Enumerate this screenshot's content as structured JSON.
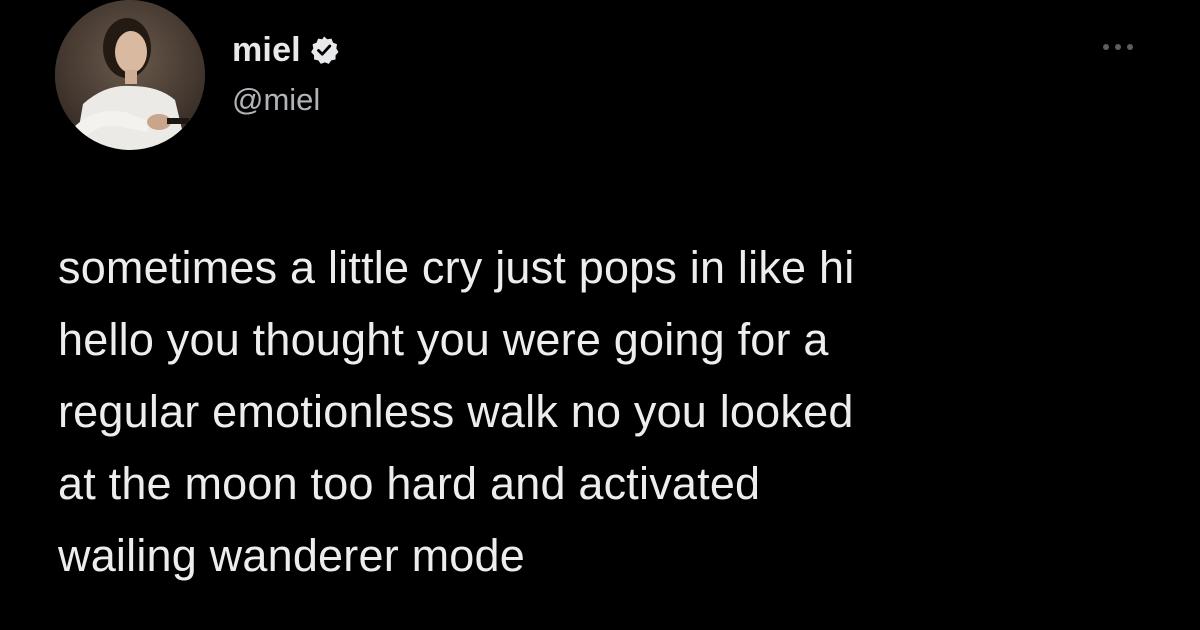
{
  "author": {
    "display_name": "miel",
    "handle": "@miel",
    "verified": true,
    "avatar_icon": "profile-photo-avatar"
  },
  "menu": {
    "more_icon": "ellipsis-icon"
  },
  "tweet": {
    "lines": [
      "sometimes a little cry just pops in like hi",
      "hello you thought you were going for a",
      "regular emotionless walk no you looked",
      "at the moon too hard and activated",
      "wailing wanderer mode"
    ]
  },
  "colors": {
    "background": "#000000",
    "text_primary": "#e7e9ea",
    "text_secondary": "#b0b3b8"
  }
}
